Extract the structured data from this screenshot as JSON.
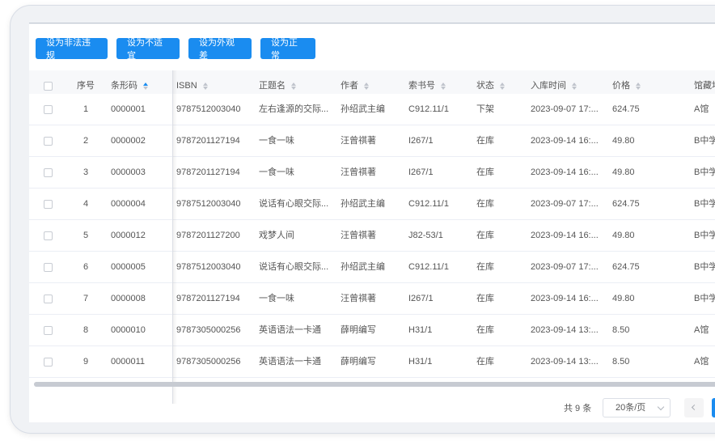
{
  "toolbar": {
    "buttons": [
      "设为非法违规",
      "设为不适宜",
      "设为外观差",
      "设为正常"
    ]
  },
  "table": {
    "columns": [
      "序号",
      "条形码",
      "ISBN",
      "正题名",
      "作者",
      "索书号",
      "状态",
      "入库时间",
      "价格",
      "馆藏地"
    ],
    "rows": [
      [
        "1",
        "0000001",
        "9787512003040",
        "左右逢源的交际...",
        "孙绍武主编",
        "C912.11/1",
        "下架",
        "2023-09-07 17:...",
        "624.75",
        "A馆"
      ],
      [
        "2",
        "0000002",
        "9787201127194",
        "一食一味",
        "汪曾祺著",
        "I267/1",
        "在库",
        "2023-09-14 16:...",
        "49.80",
        "B中学"
      ],
      [
        "3",
        "0000003",
        "9787201127194",
        "一食一味",
        "汪曾祺著",
        "I267/1",
        "在库",
        "2023-09-14 16:...",
        "49.80",
        "B中学"
      ],
      [
        "4",
        "0000004",
        "9787512003040",
        "说话有心眼交际...",
        "孙绍武主编",
        "C912.11/1",
        "在库",
        "2023-09-07 17:...",
        "624.75",
        "B中学"
      ],
      [
        "5",
        "0000012",
        "9787201127200",
        "戏梦人间",
        "汪曾祺著",
        "J82-53/1",
        "在库",
        "2023-09-14 16:...",
        "49.80",
        "B中学"
      ],
      [
        "6",
        "0000005",
        "9787512003040",
        "说话有心眼交际...",
        "孙绍武主编",
        "C912.11/1",
        "在库",
        "2023-09-07 17:...",
        "624.75",
        "B中学"
      ],
      [
        "7",
        "0000008",
        "9787201127194",
        "一食一味",
        "汪曾祺著",
        "I267/1",
        "在库",
        "2023-09-14 16:...",
        "49.80",
        "B中学"
      ],
      [
        "8",
        "0000010",
        "9787305000256",
        "英语语法一卡通",
        "薛明编写",
        "H31/1",
        "在库",
        "2023-09-14 13:...",
        "8.50",
        "A馆"
      ],
      [
        "9",
        "0000011",
        "9787305000256",
        "英语语法一卡通",
        "薛明编写",
        "H31/1",
        "在库",
        "2023-09-14 13:...",
        "8.50",
        "A馆"
      ]
    ]
  },
  "pagination": {
    "total_text": "共 9 条",
    "page_size": "20条/页"
  },
  "colors": {
    "primary": "#1a8cf0",
    "header_bg": "#f7f8fa",
    "border": "#ebeef5"
  }
}
